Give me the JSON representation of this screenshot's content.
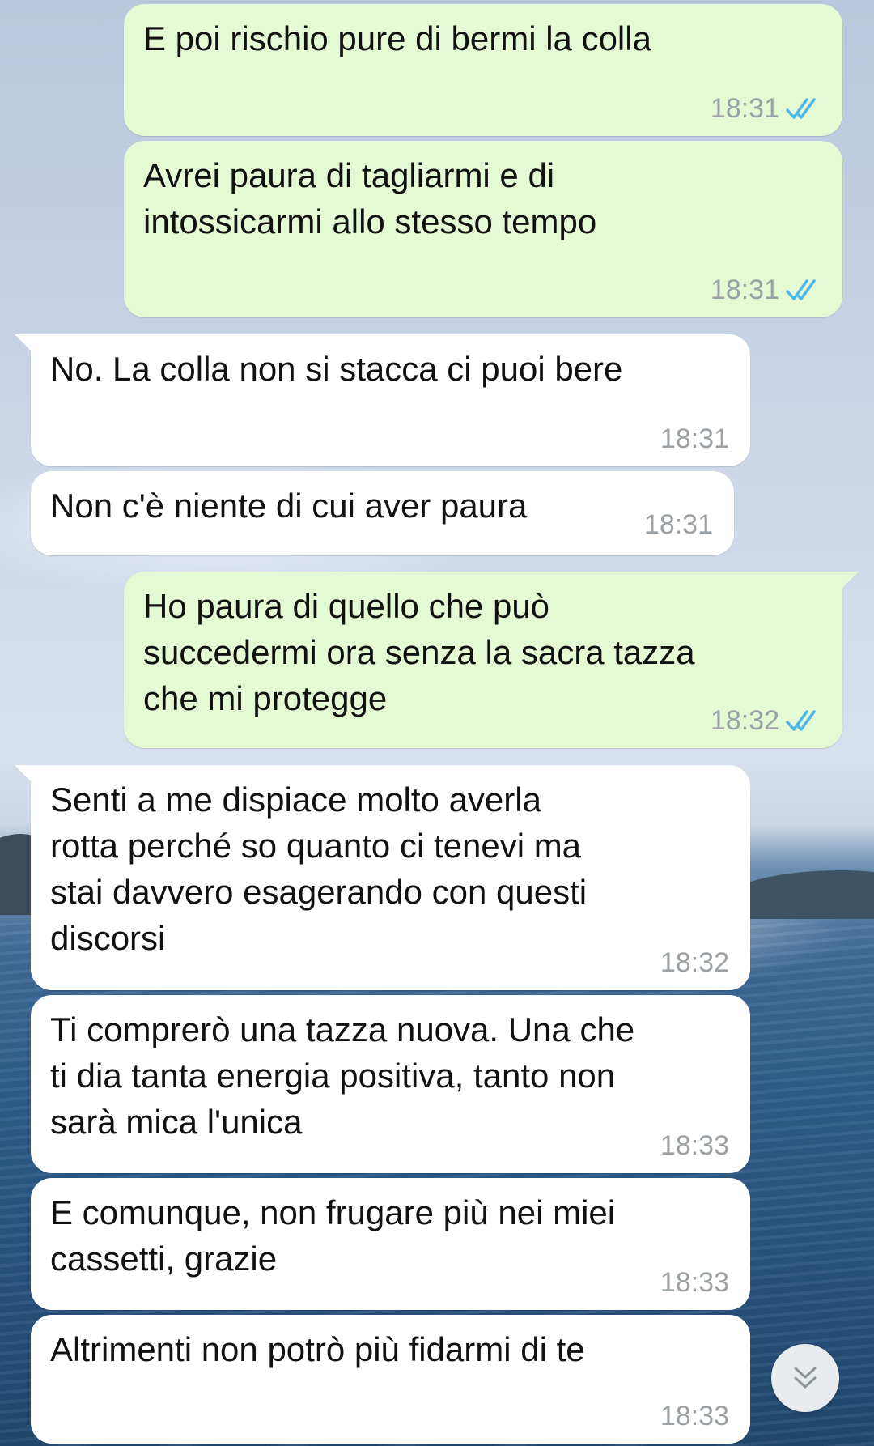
{
  "messages": [
    {
      "direction": "out",
      "text": "E poi rischio pure di bermi la colla",
      "time": "18:31",
      "read": true
    },
    {
      "direction": "out",
      "text": "Avrei paura di tagliarmi e di\nintossicarmi allo stesso tempo",
      "time": "18:31",
      "read": true
    },
    {
      "direction": "in",
      "text": "No. La colla non si stacca ci puoi bere",
      "time": "18:31"
    },
    {
      "direction": "in",
      "text": "Non c'è niente di cui aver paura",
      "time": "18:31"
    },
    {
      "direction": "out",
      "text": "Ho paura di quello che può\nsuccedermi ora senza la sacra tazza\nche mi protegge",
      "time": "18:32",
      "read": true
    },
    {
      "direction": "in",
      "text": "Senti a me dispiace molto averla\nrotta perché so quanto ci tenevi ma\nstai davvero esagerando con questi\ndiscorsi",
      "time": "18:32"
    },
    {
      "direction": "in",
      "text": "Ti comprerò una tazza nuova. Una che\nti dia tanta energia positiva, tanto non\nsarà mica l'unica",
      "time": "18:33"
    },
    {
      "direction": "in",
      "text": "E comunque, non frugare più nei miei\ncassetti, grazie",
      "time": "18:33"
    },
    {
      "direction": "in",
      "text": "Altrimenti non potrò più fidarmi di te",
      "time": "18:33"
    }
  ],
  "colors": {
    "outgoing_bubble": "#e3fad4",
    "incoming_bubble": "#ffffff",
    "read_check": "#4fb6ec",
    "timestamp": "#9aa0a3"
  },
  "icons": {
    "read_receipt": "double-check-icon",
    "scroll_down": "double-chevron-down-icon"
  }
}
